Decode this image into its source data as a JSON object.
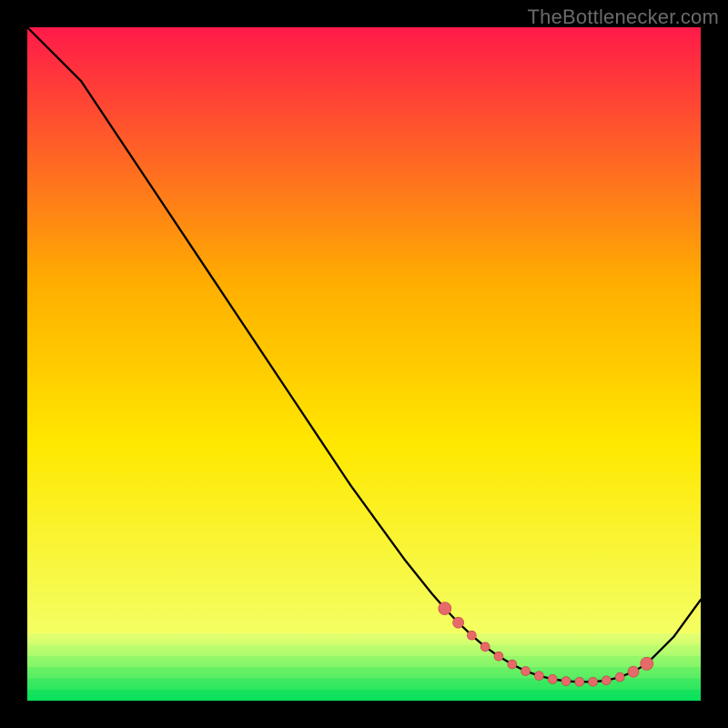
{
  "watermark": "TheBottlenecker.com",
  "chart_data": {
    "type": "line",
    "title": "",
    "xlabel": "",
    "ylabel": "",
    "xlim": [
      0,
      100
    ],
    "ylim": [
      0,
      100
    ],
    "series": [
      {
        "name": "curve",
        "x": [
          0,
          4,
          8,
          12,
          16,
          20,
          24,
          28,
          32,
          36,
          40,
          44,
          48,
          52,
          56,
          60,
          62,
          64,
          66,
          68,
          70,
          72,
          74,
          76,
          78,
          80,
          82,
          84,
          86,
          88,
          90,
          92,
          96,
          100
        ],
        "y": [
          100,
          96,
          92,
          86,
          80,
          74,
          68,
          62,
          56,
          50,
          44,
          38,
          32,
          26.5,
          21,
          16,
          13.7,
          11.6,
          9.7,
          8.0,
          6.6,
          5.4,
          4.4,
          3.7,
          3.2,
          2.9,
          2.8,
          2.8,
          3.0,
          3.5,
          4.3,
          5.5,
          9.5,
          15
        ]
      }
    ],
    "markers": {
      "name": "highlight-points",
      "x": [
        62,
        64,
        66,
        68,
        70,
        72,
        74,
        76,
        78,
        80,
        82,
        84,
        86,
        88,
        90,
        92
      ],
      "y": [
        13.7,
        11.6,
        9.7,
        8.0,
        6.6,
        5.4,
        4.4,
        3.7,
        3.2,
        2.9,
        2.8,
        2.8,
        3.0,
        3.5,
        4.3,
        5.5
      ],
      "r": [
        7,
        6,
        5,
        5,
        5,
        5,
        5,
        5,
        5,
        5,
        5,
        5,
        5,
        5,
        6,
        7
      ]
    },
    "gradient_background": {
      "top_color": "#ff1a49",
      "mid_colors": [
        "#ffae00",
        "#ffe800",
        "#f4ff63"
      ],
      "bottom_color": "#00e55a"
    }
  }
}
